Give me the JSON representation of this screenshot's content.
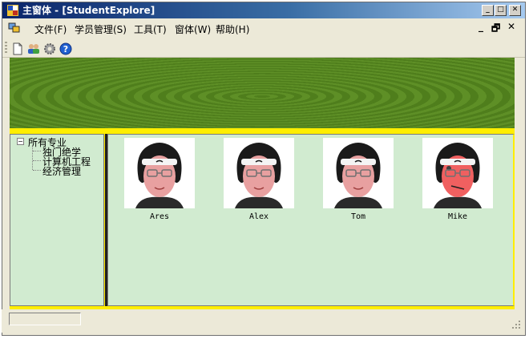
{
  "window": {
    "title": "主窗体 - [StudentExplore]",
    "minimize_glyph": "_",
    "maximize_glyph": "□",
    "close_glyph": "✕"
  },
  "menu": {
    "items": [
      {
        "label": "文件(F)"
      },
      {
        "label": "学员管理(S)"
      },
      {
        "label": "工具(T)"
      },
      {
        "label": "窗体(W)"
      },
      {
        "label": "帮助(H)"
      }
    ],
    "mdi_minimize_glyph": "_",
    "mdi_restore_glyph": "🗗",
    "mdi_close_glyph": "✕"
  },
  "toolbar": {
    "buttons": [
      {
        "icon": "new-document-icon"
      },
      {
        "icon": "users-icon"
      },
      {
        "icon": "gear-icon"
      },
      {
        "icon": "help-icon"
      }
    ]
  },
  "tree": {
    "toggle": "−",
    "root": "所有专业",
    "children": [
      "独门绝学",
      "计算机工程",
      "经济管理"
    ]
  },
  "students": [
    {
      "name": "Ares",
      "face_color": "#e8a0a0"
    },
    {
      "name": "Alex",
      "face_color": "#e8a0a0"
    },
    {
      "name": "Tom",
      "face_color": "#e8a0a0"
    },
    {
      "name": "Mike",
      "face_color": "#f06060"
    }
  ],
  "colors": {
    "accent_yellow": "#ffee00",
    "panel_green": "#d1ebd0",
    "banner_green": "#5e8f26"
  }
}
